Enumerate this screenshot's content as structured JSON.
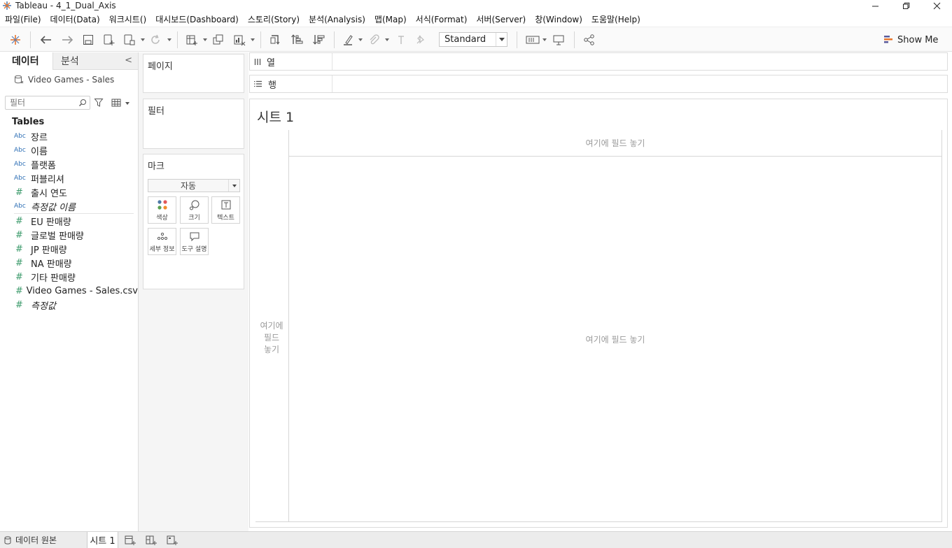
{
  "window": {
    "title": "Tableau - 4_1_Dual_Axis"
  },
  "menu": [
    "파일(File)",
    "데이터(Data)",
    "워크시트()",
    "대시보드(Dashboard)",
    "스토리(Story)",
    "분석(Analysis)",
    "맵(Map)",
    "서식(Format)",
    "서버(Server)",
    "창(Window)",
    "도움말(Help)"
  ],
  "toolbar": {
    "fit_value": "Standard",
    "show_me_label": "Show Me"
  },
  "datapane": {
    "tab_data": "데이터",
    "tab_analytics": "분석",
    "collapse_glyph": "<",
    "datasource": "Video Games - Sales",
    "search_placeholder": "필터",
    "tables_header": "Tables",
    "dimensions": [
      {
        "type": "Abc",
        "name": "장르",
        "italic": false
      },
      {
        "type": "Abc",
        "name": "이름",
        "italic": false
      },
      {
        "type": "Abc",
        "name": "플랫폼",
        "italic": false
      },
      {
        "type": "Abc",
        "name": "퍼블리셔",
        "italic": false
      },
      {
        "type": "#",
        "name": "출시 연도",
        "italic": false
      },
      {
        "type": "Abc",
        "name": "측정값 이름",
        "italic": true
      }
    ],
    "measures": [
      {
        "type": "#",
        "name": "EU 판매량",
        "italic": false
      },
      {
        "type": "#",
        "name": "글로벌 판매량",
        "italic": false
      },
      {
        "type": "#",
        "name": "JP 판매량",
        "italic": false
      },
      {
        "type": "#",
        "name": "NA 판매량",
        "italic": false
      },
      {
        "type": "#",
        "name": "기타 판매량",
        "italic": false
      },
      {
        "type": "#",
        "name": "Video Games - Sales.csv",
        "italic": false
      },
      {
        "type": "#",
        "name": "측정값",
        "italic": true
      }
    ]
  },
  "cards": {
    "pages_title": "페이지",
    "filters_title": "필터",
    "marks_title": "마크",
    "marks_type": "자동",
    "marks_buttons": [
      "색상",
      "크기",
      "텍스트",
      "세부 정보",
      "도구 설명"
    ]
  },
  "shelves": {
    "columns_label": "열",
    "rows_label": "행"
  },
  "sheet": {
    "title": "시트 1",
    "drop_top": "여기에 필드 놓기",
    "drop_left": [
      "여기에",
      "필드",
      "놓기"
    ],
    "drop_center": "여기에 필드 놓기"
  },
  "bottom": {
    "datasource_tab": "데이터 원본",
    "sheet_tab": "시트 1"
  },
  "colors": {
    "abc_type": "#2e6fb5",
    "number_type": "#3d9b6c",
    "tableau_orange": "#e8762d",
    "tableau_blue": "#1f77b4"
  }
}
